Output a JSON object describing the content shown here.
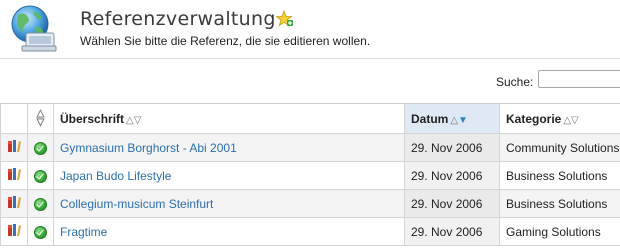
{
  "header": {
    "title": "Referenzverwaltung",
    "subtitle": "Wählen Sie bitte die Referenz, die sie editieren wollen."
  },
  "search": {
    "label": "Suche:",
    "value": "",
    "placeholder": ""
  },
  "table": {
    "columns": {
      "title": "Überschrift",
      "date": "Datum",
      "category": "Kategorie"
    },
    "sort_arrows": "△▽",
    "sorted_column": "Datum",
    "sort_direction": "descending",
    "rows": [
      {
        "title": "Gymnasium Borghorst - Abi 2001",
        "date": "29. Nov 2006",
        "category": "Community Solutions"
      },
      {
        "title": "Japan Budo Lifestyle",
        "date": "29. Nov 2006",
        "category": "Business Solutions"
      },
      {
        "title": "Collegium-musicum Steinfurt",
        "date": "29. Nov 2006",
        "category": "Business Solutions"
      },
      {
        "title": "Fragtime",
        "date": "29. Nov 2006",
        "category": "Gaming Solutions"
      }
    ]
  },
  "icons": {
    "logo": "globe-computer-icon",
    "add": "add-star-icon",
    "edit": "edit-tools-icon",
    "status": "active-check-icon"
  },
  "colors": {
    "link": "#2c6fb3",
    "sorted_header": "#dfe9f5",
    "status": "#2a9a2a"
  }
}
